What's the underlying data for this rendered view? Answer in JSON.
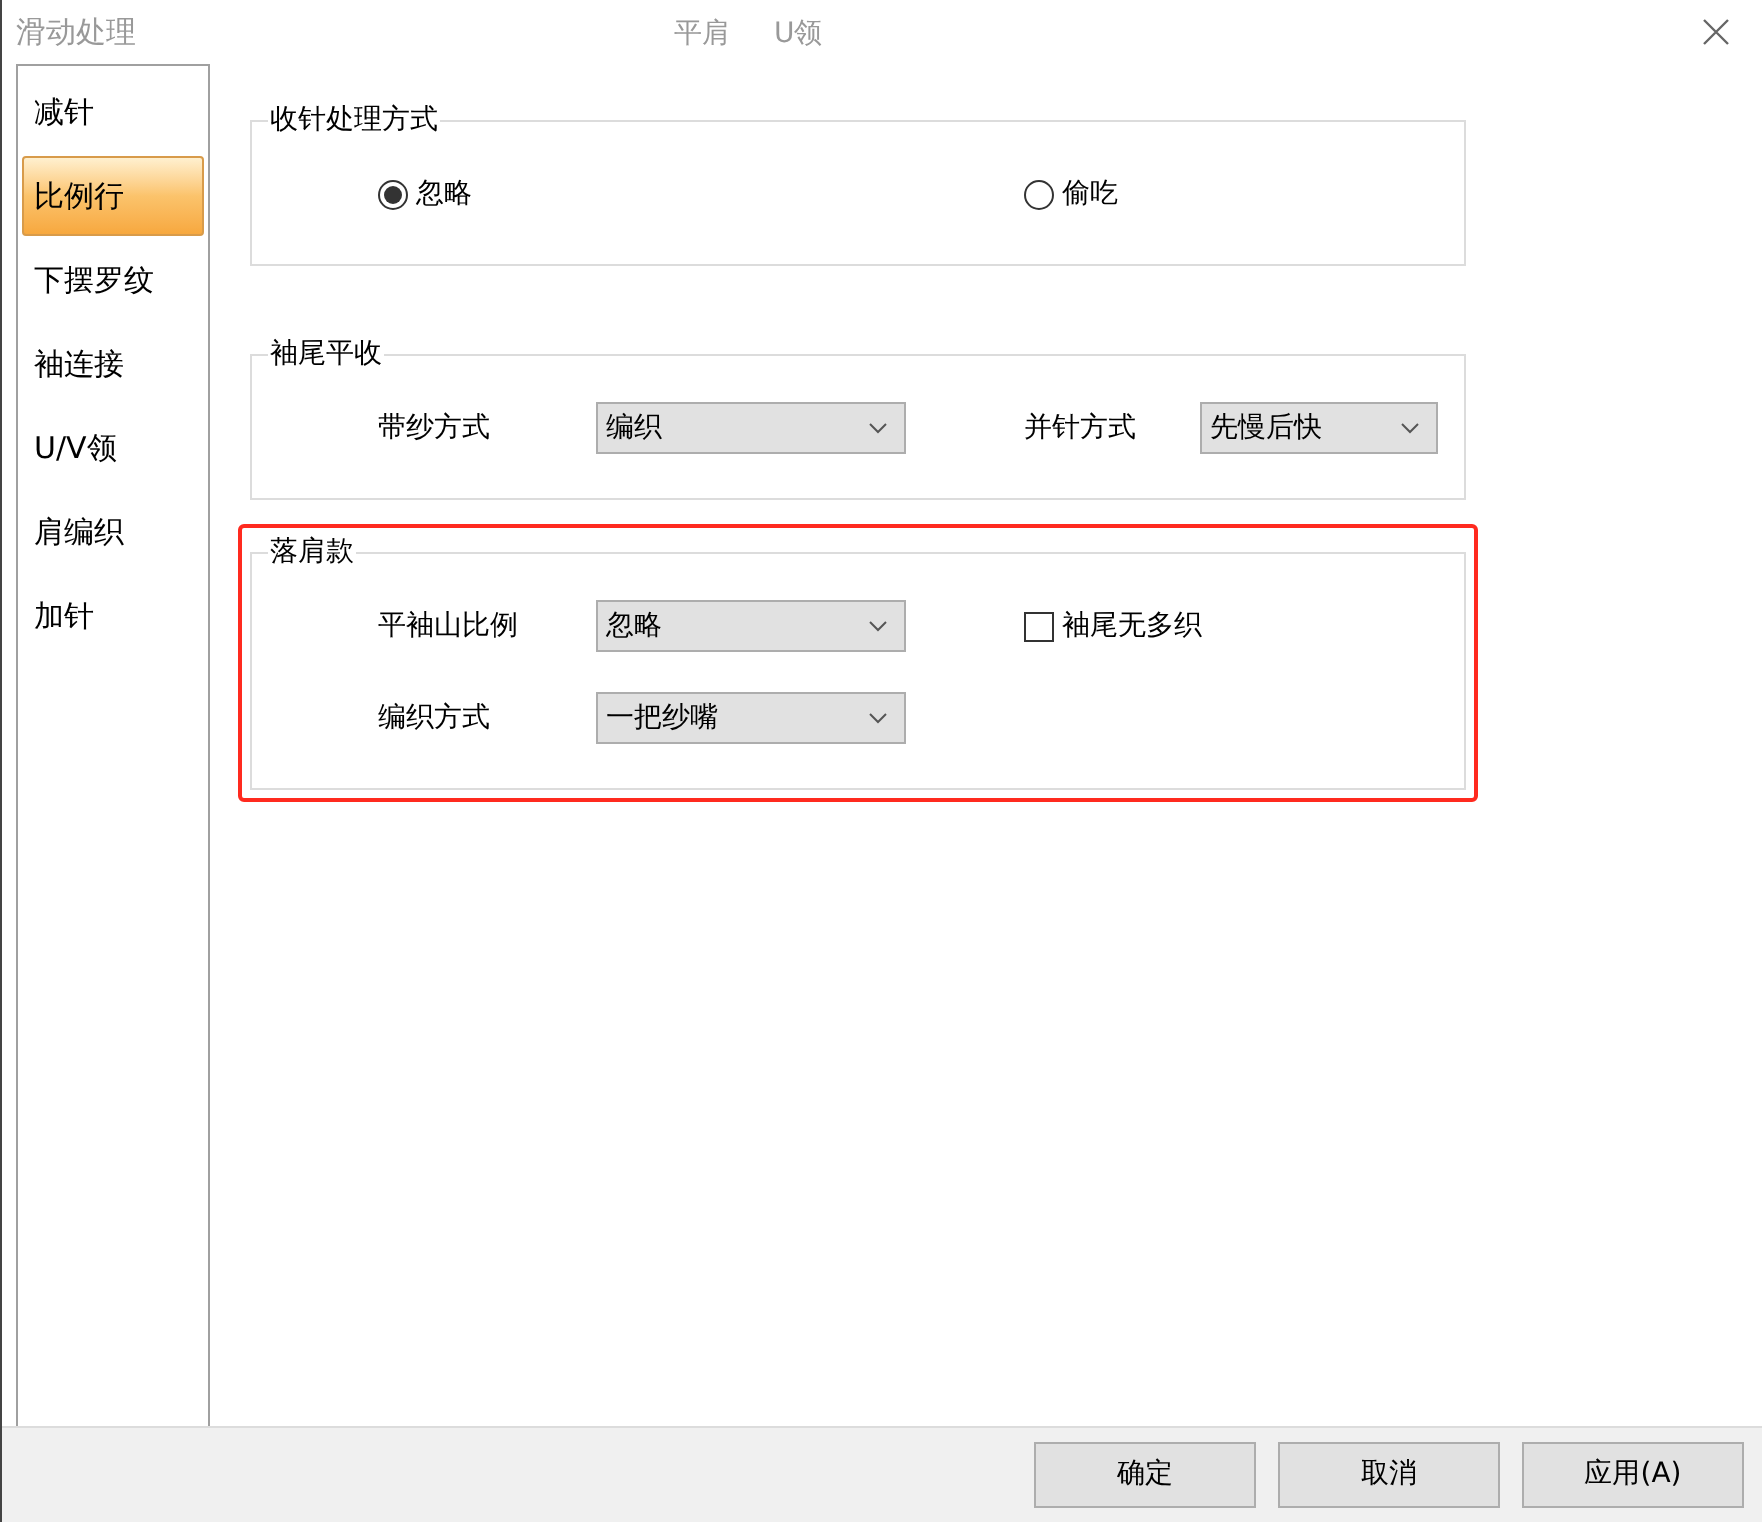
{
  "window": {
    "title": "滑动处理",
    "subtitles": [
      "平肩",
      "U领"
    ]
  },
  "sidebar": {
    "items": [
      {
        "label": "减针",
        "selected": false
      },
      {
        "label": "比例行",
        "selected": true
      },
      {
        "label": "下摆罗纹",
        "selected": false
      },
      {
        "label": "袖连接",
        "selected": false
      },
      {
        "label": "U/V领",
        "selected": false
      },
      {
        "label": "肩编织",
        "selected": false
      },
      {
        "label": "加针",
        "selected": false
      }
    ]
  },
  "groups": [
    {
      "title": "收针处理方式",
      "highlighted": false,
      "rows": [
        [
          {
            "kind": "radio",
            "label": "忽略",
            "selected": true
          },
          {
            "kind": "radio",
            "label": "偷吃",
            "selected": false
          }
        ]
      ]
    },
    {
      "title": "袖尾平收",
      "highlighted": false,
      "rows": [
        [
          {
            "kind": "select",
            "label": "带纱方式",
            "value": "编织"
          },
          {
            "kind": "select",
            "label": "并针方式",
            "value": "先慢后快"
          }
        ]
      ]
    },
    {
      "title": "落肩款",
      "highlighted": true,
      "rows": [
        [
          {
            "kind": "select",
            "label": "平袖山比例",
            "value": "忽略"
          },
          {
            "kind": "checkbox",
            "label": "袖尾无多织",
            "checked": false
          }
        ],
        [
          {
            "kind": "select",
            "label": "编织方式",
            "value": "一把纱嘴"
          }
        ]
      ]
    }
  ],
  "buttons": [
    "确定",
    "取消",
    "应用(A)"
  ]
}
